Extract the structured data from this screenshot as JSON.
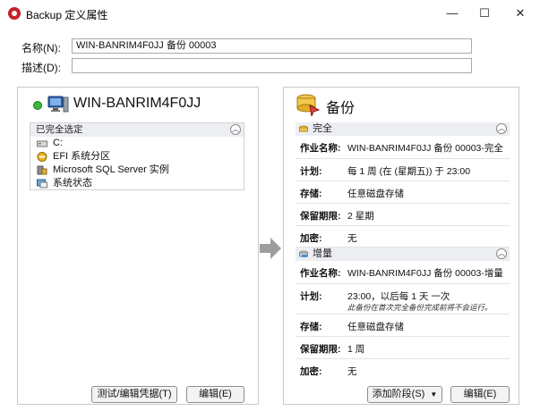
{
  "window": {
    "title": "Backup 定义属性",
    "controls": {
      "minimize": "—",
      "maximize": "☐",
      "close": "✕"
    }
  },
  "form": {
    "name_label": "名称(N):",
    "name_value": "WIN-BANRIM4F0JJ 备份 00003",
    "desc_label": "描述(D):",
    "desc_value": ""
  },
  "source": {
    "host_name": "WIN-BANRIM4F0JJ",
    "selection_header": "已完全选定",
    "items": [
      {
        "label": "C:",
        "icon": "drive-icon"
      },
      {
        "label": "EFI 系统分区",
        "icon": "efi-partition-icon"
      },
      {
        "label": "Microsoft SQL Server 实例",
        "icon": "sql-server-icon"
      },
      {
        "label": "系统状态",
        "icon": "system-state-icon"
      }
    ],
    "buttons": {
      "test_edit": "测试/编辑凭据(T)",
      "edit": "编辑(E)"
    }
  },
  "backup": {
    "title": "备份",
    "full": {
      "header": "完全",
      "rows": [
        {
          "key": "作业名称:",
          "value": "WIN-BANRIM4F0JJ 备份 00003-完全"
        },
        {
          "key": "计划:",
          "value": "每 1 周 (在 (星期五)) 于 23:00"
        },
        {
          "key": "存储:",
          "value": "任意磁盘存储"
        },
        {
          "key": "保留期限:",
          "value": "2 星期"
        },
        {
          "key": "加密:",
          "value": "无"
        }
      ]
    },
    "incremental": {
      "header": "增量",
      "rows": [
        {
          "key": "作业名称:",
          "value": "WIN-BANRIM4F0JJ 备份 00003-增量"
        },
        {
          "key": "计划:",
          "value": "23:00，以后每 1 天 一次",
          "note": "此备份在首次完全备份完成前将不会运行。"
        },
        {
          "key": "存储:",
          "value": "任意磁盘存储"
        },
        {
          "key": "保留期限:",
          "value": "1 周"
        },
        {
          "key": "加密:",
          "value": "无"
        }
      ]
    },
    "buttons": {
      "add_stage": "添加阶段(S)",
      "add_stage_arrow": "▼",
      "edit": "编辑(E)"
    }
  },
  "colors": {
    "accent_red": "#c8202a",
    "header_bg": "#eceef2",
    "status_green": "#3cb43c"
  }
}
